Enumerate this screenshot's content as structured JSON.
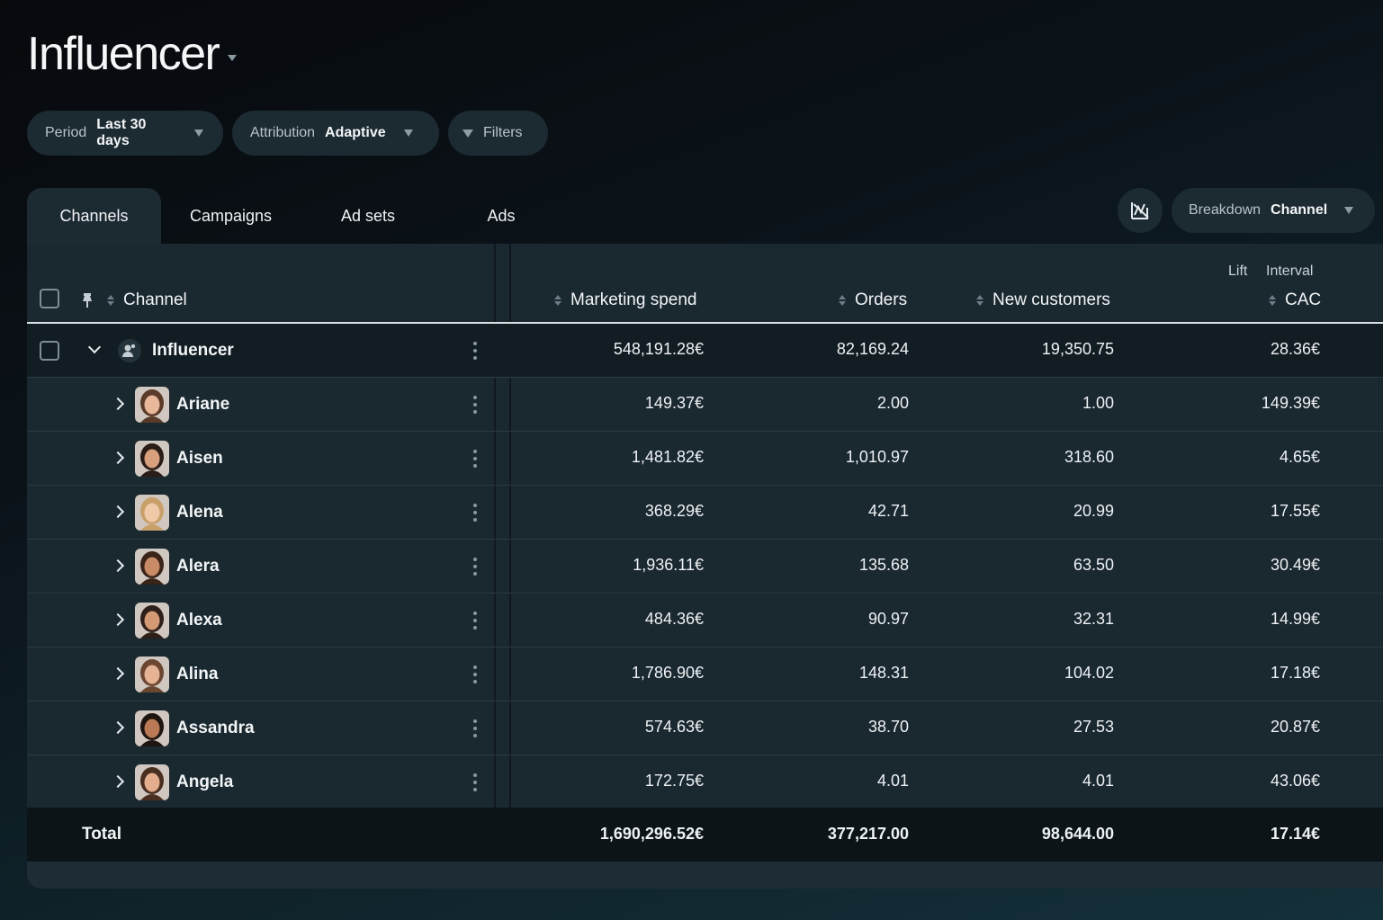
{
  "page": {
    "title": "Influencer"
  },
  "filters": {
    "period_label": "Period",
    "period_value": "Last 30 days",
    "attribution_label": "Attribution",
    "attribution_value": "Adaptive",
    "filters_label": "Filters"
  },
  "tabs": [
    {
      "label": "Channels",
      "active": true
    },
    {
      "label": "Campaigns",
      "active": false
    },
    {
      "label": "Ad sets",
      "active": false
    },
    {
      "label": "Ads",
      "active": false
    }
  ],
  "breakdown": {
    "label": "Breakdown",
    "value": "Channel"
  },
  "table": {
    "columns": {
      "channel": "Channel",
      "marketing_spend": "Marketing spend",
      "orders": "Orders",
      "new_customers": "New customers",
      "cac": "CAC",
      "lift": "Lift",
      "interval": "Interval"
    },
    "parent": {
      "name": "Influencer",
      "marketing_spend": "548,191.28€",
      "orders": "82,169.24",
      "new_customers": "19,350.75",
      "cac": "28.36€"
    },
    "rows": [
      {
        "name": "Ariane",
        "marketing_spend": "149.37€",
        "orders": "2.00",
        "new_customers": "1.00",
        "cac": "149.39€"
      },
      {
        "name": "Aisen",
        "marketing_spend": "1,481.82€",
        "orders": "1,010.97",
        "new_customers": "318.60",
        "cac": "4.65€"
      },
      {
        "name": "Alena",
        "marketing_spend": "368.29€",
        "orders": "42.71",
        "new_customers": "20.99",
        "cac": "17.55€"
      },
      {
        "name": "Alera",
        "marketing_spend": "1,936.11€",
        "orders": "135.68",
        "new_customers": "63.50",
        "cac": "30.49€"
      },
      {
        "name": "Alexa",
        "marketing_spend": "484.36€",
        "orders": "90.97",
        "new_customers": "32.31",
        "cac": "14.99€"
      },
      {
        "name": "Alina",
        "marketing_spend": "1,786.90€",
        "orders": "148.31",
        "new_customers": "104.02",
        "cac": "17.18€"
      },
      {
        "name": "Assandra",
        "marketing_spend": "574.63€",
        "orders": "38.70",
        "new_customers": "27.53",
        "cac": "20.87€"
      },
      {
        "name": "Angela",
        "marketing_spend": "172.75€",
        "orders": "4.01",
        "new_customers": "4.01",
        "cac": "43.06€"
      }
    ],
    "total": {
      "label": "Total",
      "marketing_spend": "1,690,296.52€",
      "orders": "377,217.00",
      "new_customers": "98,644.00",
      "cac": "17.14€"
    }
  }
}
